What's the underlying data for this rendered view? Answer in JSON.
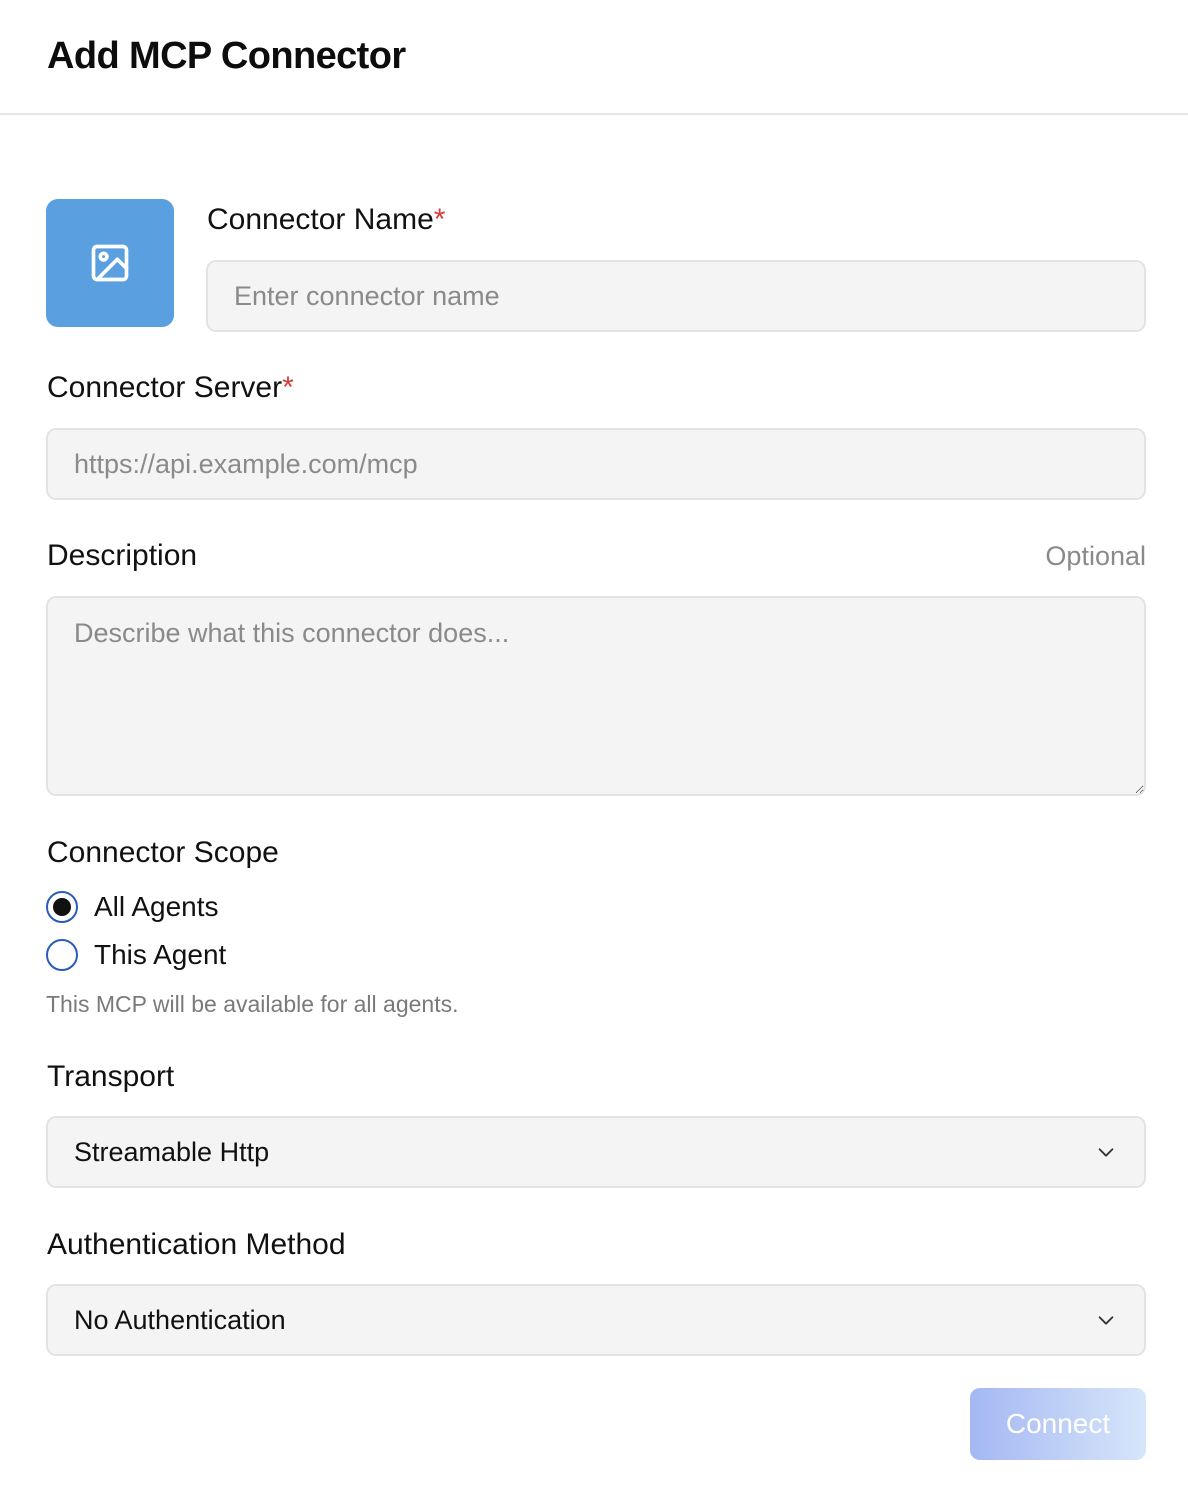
{
  "header": {
    "title": "Add MCP Connector"
  },
  "logo": {
    "icon": "image-icon",
    "color": "#5a9fdf"
  },
  "connector_name": {
    "label": "Connector Name",
    "required_mark": "*",
    "placeholder": "Enter connector name",
    "value": ""
  },
  "connector_server": {
    "label": "Connector Server",
    "required_mark": "*",
    "placeholder": "https://api.example.com/mcp",
    "value": ""
  },
  "description": {
    "label": "Description",
    "optional_label": "Optional",
    "placeholder": "Describe what this connector does...",
    "value": ""
  },
  "scope": {
    "label": "Connector Scope",
    "options": [
      {
        "label": "All Agents",
        "selected": true
      },
      {
        "label": "This Agent",
        "selected": false
      }
    ],
    "hint": "This MCP will be available for all agents."
  },
  "transport": {
    "label": "Transport",
    "selected": "Streamable Http"
  },
  "auth": {
    "label": "Authentication Method",
    "selected": "No Authentication"
  },
  "actions": {
    "connect_label": "Connect"
  },
  "colors": {
    "required": "#d93b3b",
    "radio_border": "#2b5bb8",
    "button_gradient_start": "#a5b7f3",
    "button_gradient_end": "#d6e6fa"
  }
}
